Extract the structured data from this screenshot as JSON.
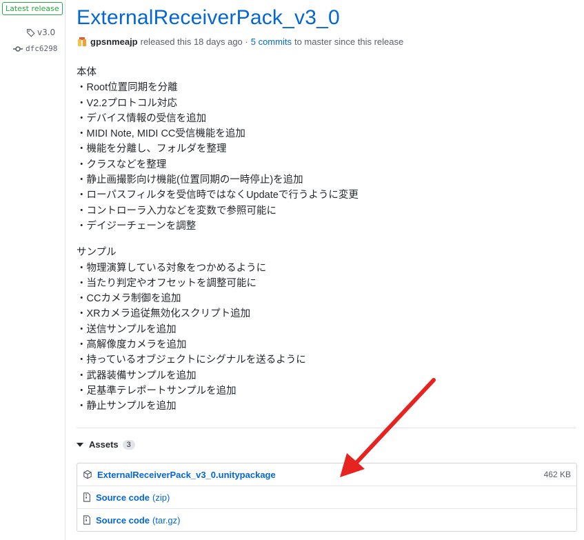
{
  "sidebar": {
    "latest_label": "Latest release",
    "tag": "v3.0",
    "commit": "dfc6298"
  },
  "release": {
    "title": "ExternalReceiverPack_v3_0",
    "author": "gpsnmeajp",
    "released_text": "released this 18 days ago ·",
    "commits_link": "5 commits",
    "since_text": "to master since this release"
  },
  "notes": {
    "section1_title": "本体",
    "section1_items": [
      "・Root位置同期を分離",
      "・V2.2プロトコル対応",
      "・デバイス情報の受信を追加",
      "・MIDI Note, MIDI CC受信機能を追加",
      "・機能を分離し、フォルダを整理",
      "・クラスなどを整理",
      "・静止画撮影向け機能(位置同期の一時停止)を追加",
      "・ローパスフィルタを受信時ではなくUpdateで行うように変更",
      "・コントローラ入力などを変数で参照可能に",
      "・デイジーチェーンを調整"
    ],
    "section2_title": "サンプル",
    "section2_items": [
      "・物理演算している対象をつかめるように",
      "・当たり判定やオフセットを調整可能に",
      "・CCカメラ制御を追加",
      "・XRカメラ追従無効化スクリプト追加",
      "・送信サンプルを追加",
      "・高解像度カメラを追加",
      "・持っているオブジェクトにシグナルを送るように",
      "・武器装備サンプルを追加",
      "・足基準テレポートサンプルを追加",
      "・静止サンプルを追加"
    ]
  },
  "assets": {
    "heading": "Assets",
    "count": "3",
    "items": [
      {
        "name": "ExternalReceiverPack_v3_0.unitypackage",
        "ext": "",
        "size": "462 KB",
        "icon": "package-icon"
      },
      {
        "name": "Source code",
        "ext": "(zip)",
        "size": "",
        "icon": "file-zip-icon"
      },
      {
        "name": "Source code",
        "ext": "(tar.gz)",
        "size": "",
        "icon": "file-zip-icon"
      }
    ]
  },
  "colors": {
    "link": "#0366d6",
    "latest_green": "#28a745",
    "annotation_arrow": "#e8231f"
  }
}
